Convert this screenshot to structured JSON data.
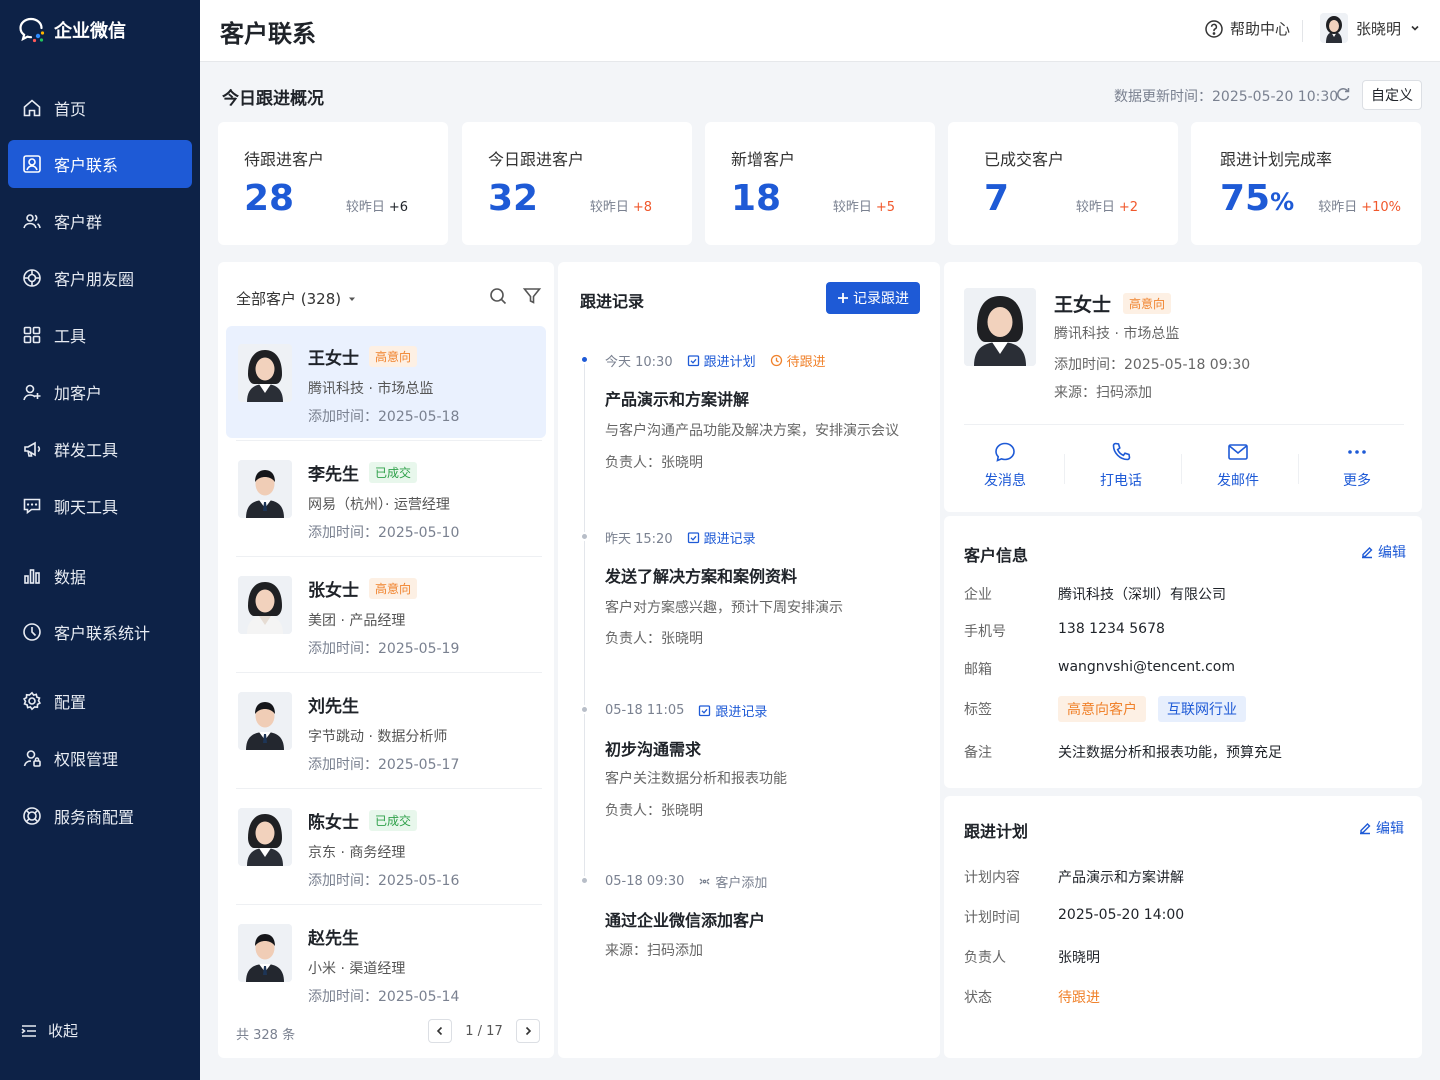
{
  "app": {
    "name": "企业微信"
  },
  "sidebar": {
    "items": [
      {
        "label": "首页",
        "icon": "home-icon"
      },
      {
        "label": "客户联系",
        "icon": "contacts-icon",
        "active": true
      },
      {
        "label": "客户群",
        "icon": "group-icon"
      },
      {
        "label": "客户朋友圈",
        "icon": "moments-icon"
      },
      {
        "label": "工具",
        "icon": "tools-icon"
      },
      {
        "label": "加客户",
        "icon": "add-user-icon"
      },
      {
        "label": "群发工具",
        "icon": "megaphone-icon"
      },
      {
        "label": "聊天工具",
        "icon": "chat-icon"
      },
      {
        "label": "数据",
        "icon": "bar-chart-icon"
      },
      {
        "label": "客户联系统计",
        "icon": "pie-chart-icon"
      },
      {
        "label": "配置",
        "icon": "gear-icon"
      },
      {
        "label": "权限管理",
        "icon": "permission-icon"
      },
      {
        "label": "服务商配置",
        "icon": "service-icon"
      }
    ],
    "collapse_label": "收起"
  },
  "header": {
    "title": "客户联系",
    "help_label": "帮助中心",
    "user_name": "张晓明"
  },
  "overview": {
    "title": "今日跟进概况",
    "updated_label": "数据更新时间：",
    "updated_time": "2025-05-20 10:30",
    "customize_label": "自定义",
    "compare_label": "较昨日",
    "stats": [
      {
        "label": "待跟进客户",
        "value": "28",
        "unit": "",
        "delta": "+6",
        "delta_color": "neutral"
      },
      {
        "label": "今日跟进客户",
        "value": "32",
        "unit": "",
        "delta": "+8",
        "delta_color": "up"
      },
      {
        "label": "新增客户",
        "value": "18",
        "unit": "",
        "delta": "+5",
        "delta_color": "up"
      },
      {
        "label": "已成交客户",
        "value": "7",
        "unit": "",
        "delta": "+2",
        "delta_color": "up"
      },
      {
        "label": "跟进计划完成率",
        "value": "75",
        "unit": "%",
        "delta": "+10%",
        "delta_color": "up"
      }
    ]
  },
  "customer_list": {
    "header": "全部客户 (328)",
    "added_prefix": "添加时间：",
    "customers": [
      {
        "name": "王女士",
        "tag": "高意向",
        "tag_type": "orange",
        "org": "腾讯科技 · 市场总监",
        "added": "2025-05-18",
        "gender": "f"
      },
      {
        "name": "李先生",
        "tag": "已成交",
        "tag_type": "green",
        "org": "网易（杭州）· 运营经理",
        "added": "2025-05-10",
        "gender": "m"
      },
      {
        "name": "张女士",
        "tag": "高意向",
        "tag_type": "orange",
        "org": "美团 · 产品经理",
        "added": "2025-05-19",
        "gender": "f"
      },
      {
        "name": "刘先生",
        "tag": "",
        "tag_type": "",
        "org": "字节跳动 · 数据分析师",
        "added": "2025-05-17",
        "gender": "m"
      },
      {
        "name": "陈女士",
        "tag": "已成交",
        "tag_type": "green",
        "org": "京东 · 商务经理",
        "added": "2025-05-16",
        "gender": "f"
      },
      {
        "name": "赵先生",
        "tag": "",
        "tag_type": "",
        "org": "小米 · 渠道经理",
        "added": "2025-05-14",
        "gender": "m"
      }
    ],
    "total": "共 328 条",
    "page": "1 / 17"
  },
  "follow_records": {
    "title": "跟进记录",
    "record_button": "记录跟进",
    "owner_prefix": "负责人：",
    "records": [
      {
        "time": "今天 10:30",
        "type": "跟进计划",
        "status": "待跟进",
        "title": "产品演示和方案讲解",
        "desc": "与客户沟通产品功能及解决方案，安排演示会议",
        "owner": "张晓明"
      },
      {
        "time": "昨天 15:20",
        "type": "跟进记录",
        "status": "",
        "title": "发送了解决方案和案例资料",
        "desc": "客户对方案感兴趣，预计下周安排演示",
        "owner": "张晓明"
      },
      {
        "time": "05-18 11:05",
        "type": "跟进记录",
        "status": "",
        "title": "初步沟通需求",
        "desc": "客户关注数据分析和报表功能",
        "owner": "张晓明"
      },
      {
        "time": "05-18 09:30",
        "type": "客户添加",
        "status": "",
        "title": "通过企业微信添加客户",
        "desc": "来源：扫码添加",
        "owner": ""
      }
    ]
  },
  "profile": {
    "name": "王女士",
    "tag": "高意向",
    "org": "腾讯科技 · 市场总监",
    "added": "添加时间：2025-05-18 09:30",
    "source": "来源：扫码添加",
    "actions": [
      {
        "label": "发消息",
        "icon": "message-icon"
      },
      {
        "label": "打电话",
        "icon": "phone-icon"
      },
      {
        "label": "发邮件",
        "icon": "mail-icon"
      },
      {
        "label": "更多",
        "icon": "more-icon"
      }
    ]
  },
  "customer_info": {
    "title": "客户信息",
    "edit_label": "编辑",
    "company_label": "企业",
    "company": "腾讯科技（深圳）有限公司",
    "phone_label": "手机号",
    "phone": "138 1234 5678",
    "email_label": "邮箱",
    "email": "wangnvshi@tencent.com",
    "tags_label": "标签",
    "tags": [
      "高意向客户",
      "互联网行业"
    ],
    "note_label": "备注",
    "note": "关注数据分析和报表功能，预算充足"
  },
  "follow_plan": {
    "title": "跟进计划",
    "edit_label": "编辑",
    "content_label": "计划内容",
    "content": "产品演示和方案讲解",
    "time_label": "计划时间",
    "time": "2025-05-20 14:00",
    "owner_label": "负责人",
    "owner": "张晓明",
    "status_label": "状态",
    "status": "待跟进"
  },
  "colors": {
    "sidebar_bg": "#0d2247",
    "accent": "#1e5ad6",
    "orange": "#f0822c",
    "green": "#2fa14a",
    "up": "#f0582c"
  }
}
